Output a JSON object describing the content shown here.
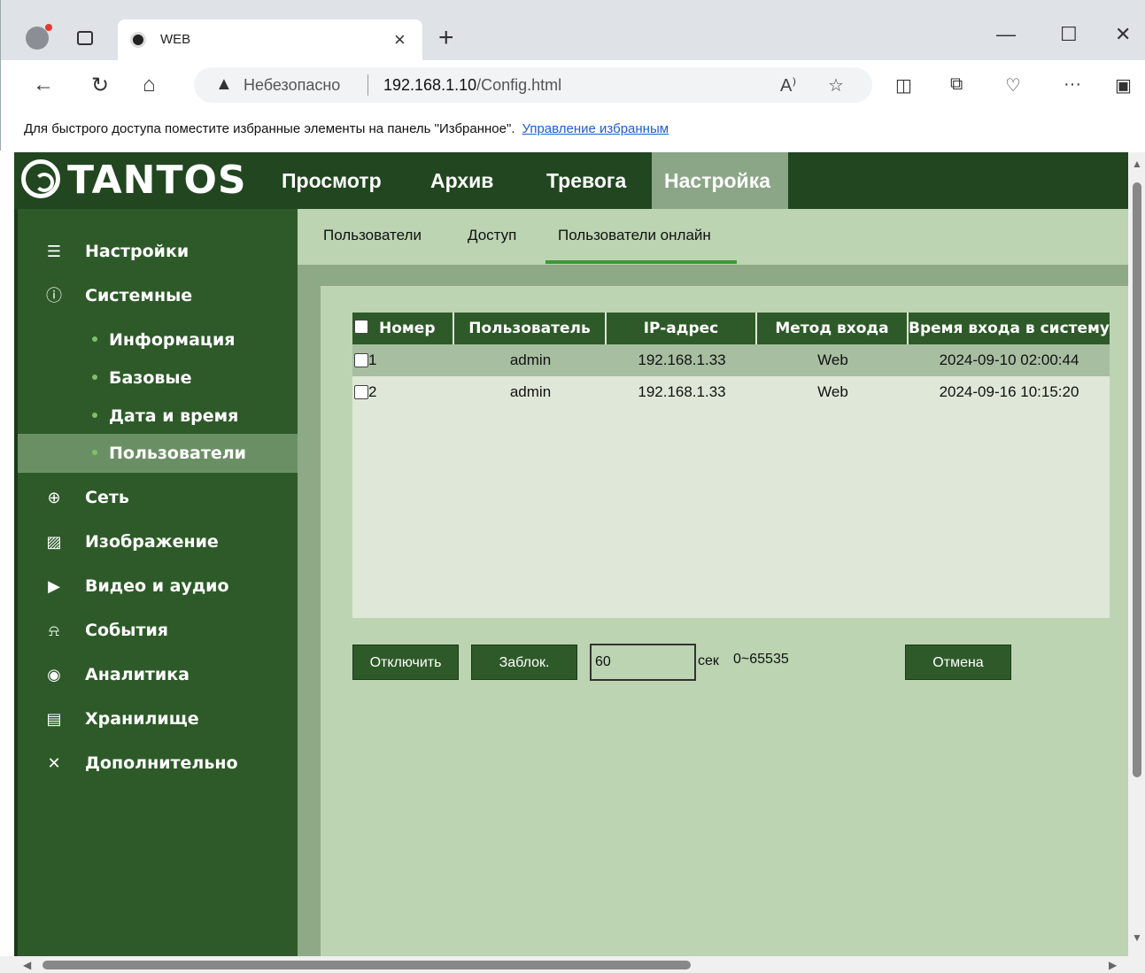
{
  "browser": {
    "tab_title": "WEB",
    "insecure_label": "Небезопасно",
    "url_host": "192.168.1.10",
    "url_path": "/Config.html",
    "favorites_text": "Для быстрого доступа поместите избранные элементы на панель \"Избранное\".",
    "favorites_link": "Управление избранным"
  },
  "app": {
    "logo": "TANTOS",
    "topnav": [
      "Просмотр",
      "Архив",
      "Тревога",
      "Настройка"
    ],
    "active_topnav": "Настройка"
  },
  "sidebar": {
    "items": [
      {
        "label": "Настройки",
        "icon": "list-icon"
      },
      {
        "label": "Системные",
        "icon": "info-icon"
      },
      {
        "label": "Информация",
        "sub": true
      },
      {
        "label": "Базовые",
        "sub": true
      },
      {
        "label": "Дата и время",
        "sub": true
      },
      {
        "label": "Пользователи",
        "sub": true,
        "active": true
      },
      {
        "label": "Сеть",
        "icon": "globe-icon"
      },
      {
        "label": "Изображение",
        "icon": "image-icon"
      },
      {
        "label": "Видео и аудио",
        "icon": "video-icon"
      },
      {
        "label": "События",
        "icon": "bell-icon"
      },
      {
        "label": "Аналитика",
        "icon": "analytics-icon"
      },
      {
        "label": "Хранилище",
        "icon": "storage-icon"
      },
      {
        "label": "Дополнительно",
        "icon": "tools-icon"
      }
    ]
  },
  "subtabs": [
    "Пользователи",
    "Доступ",
    "Пользователи онлайн"
  ],
  "active_subtab": "Пользователи онлайн",
  "table": {
    "headers": [
      "Номер",
      "Пользователь",
      "IP-адрес",
      "Метод входа",
      "Время входа в систему"
    ],
    "rows": [
      [
        "1",
        "admin",
        "192.168.1.33",
        "Web",
        "2024-09-10 02:00:44"
      ],
      [
        "2",
        "admin",
        "192.168.1.33",
        "Web",
        "2024-09-16 10:15:20"
      ]
    ]
  },
  "actions": {
    "disconnect": "Отключить",
    "block": "Заблок.",
    "seconds_value": "60",
    "seconds_unit": "сек",
    "range": "0~65535",
    "cancel": "Отмена"
  },
  "colors": {
    "nav_dark": "#224620",
    "sidebar": "#2e5a29",
    "content_bg": "#bcd4b2",
    "accent_underline": "#3c9a37"
  }
}
